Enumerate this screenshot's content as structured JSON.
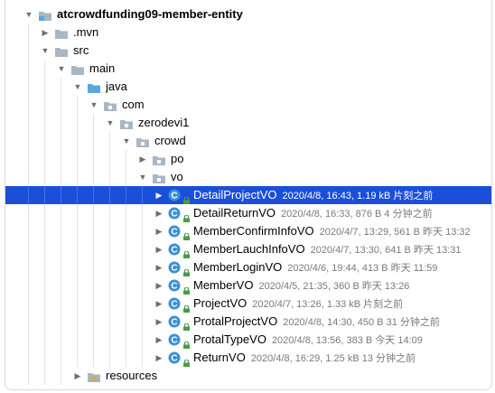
{
  "project_tree": {
    "nodes": [
      {
        "label": "atcrowdfunding09-member-entity",
        "meta": "",
        "depth": 0,
        "kind": "module",
        "arrow": "expanded",
        "bold": true,
        "selected": false
      },
      {
        "label": ".mvn",
        "meta": "",
        "depth": 1,
        "kind": "folder",
        "arrow": "collapsed",
        "bold": false,
        "selected": false
      },
      {
        "label": "src",
        "meta": "",
        "depth": 1,
        "kind": "folder",
        "arrow": "expanded",
        "bold": false,
        "selected": false
      },
      {
        "label": "main",
        "meta": "",
        "depth": 2,
        "kind": "folder",
        "arrow": "expanded",
        "bold": false,
        "selected": false
      },
      {
        "label": "java",
        "meta": "",
        "depth": 3,
        "kind": "source-folder",
        "arrow": "expanded",
        "bold": false,
        "selected": false
      },
      {
        "label": "com",
        "meta": "",
        "depth": 4,
        "kind": "package",
        "arrow": "expanded",
        "bold": false,
        "selected": false
      },
      {
        "label": "zerodevi1",
        "meta": "",
        "depth": 5,
        "kind": "package",
        "arrow": "expanded",
        "bold": false,
        "selected": false
      },
      {
        "label": "crowd",
        "meta": "",
        "depth": 6,
        "kind": "package",
        "arrow": "expanded",
        "bold": false,
        "selected": false
      },
      {
        "label": "po",
        "meta": "",
        "depth": 7,
        "kind": "package",
        "arrow": "collapsed",
        "bold": false,
        "selected": false
      },
      {
        "label": "vo",
        "meta": "",
        "depth": 7,
        "kind": "package",
        "arrow": "expanded",
        "bold": false,
        "selected": false
      },
      {
        "label": "DetailProjectVO",
        "meta": "2020/4/8, 16:43, 1.19 kB 片刻之前",
        "depth": 8,
        "kind": "class",
        "arrow": "collapsed",
        "bold": false,
        "selected": true
      },
      {
        "label": "DetailReturnVO",
        "meta": "2020/4/8, 16:33, 876 B 4 分钟之前",
        "depth": 8,
        "kind": "class",
        "arrow": "collapsed",
        "bold": false,
        "selected": false
      },
      {
        "label": "MemberConfirmInfoVO",
        "meta": "2020/4/7, 13:29, 561 B 昨天 13:32",
        "depth": 8,
        "kind": "class",
        "arrow": "collapsed",
        "bold": false,
        "selected": false
      },
      {
        "label": "MemberLauchInfoVO",
        "meta": "2020/4/7, 13:30, 641 B 昨天 13:31",
        "depth": 8,
        "kind": "class",
        "arrow": "collapsed",
        "bold": false,
        "selected": false
      },
      {
        "label": "MemberLoginVO",
        "meta": "2020/4/6, 19:44, 413 B 昨天 11:59",
        "depth": 8,
        "kind": "class",
        "arrow": "collapsed",
        "bold": false,
        "selected": false
      },
      {
        "label": "MemberVO",
        "meta": "2020/4/5, 21:35, 360 B 昨天 13:26",
        "depth": 8,
        "kind": "class",
        "arrow": "collapsed",
        "bold": false,
        "selected": false
      },
      {
        "label": "ProjectVO",
        "meta": "2020/4/7, 13:26, 1.33 kB 片刻之前",
        "depth": 8,
        "kind": "class",
        "arrow": "collapsed",
        "bold": false,
        "selected": false
      },
      {
        "label": "ProtalProjectVO",
        "meta": "2020/4/8, 14:30, 450 B 31 分钟之前",
        "depth": 8,
        "kind": "class",
        "arrow": "collapsed",
        "bold": false,
        "selected": false
      },
      {
        "label": "ProtalTypeVO",
        "meta": "2020/4/8, 13:56, 383 B 今天 14:09",
        "depth": 8,
        "kind": "class",
        "arrow": "collapsed",
        "bold": false,
        "selected": false
      },
      {
        "label": "ReturnVO",
        "meta": "2020/4/8, 16:29, 1.25 kB 13 分钟之前",
        "depth": 8,
        "kind": "class",
        "arrow": "collapsed",
        "bold": false,
        "selected": false
      },
      {
        "label": "resources",
        "meta": "",
        "depth": 3,
        "kind": "resources-folder",
        "arrow": "collapsed",
        "bold": false,
        "selected": false
      }
    ]
  },
  "colors": {
    "selection": "#1b4fd9",
    "folder": "#a9b6c4",
    "source_folder": "#5aa7e0",
    "class_icon": "#3d8fd6",
    "lock": "#4c9a4c",
    "meta_text": "#7a7a7a"
  }
}
